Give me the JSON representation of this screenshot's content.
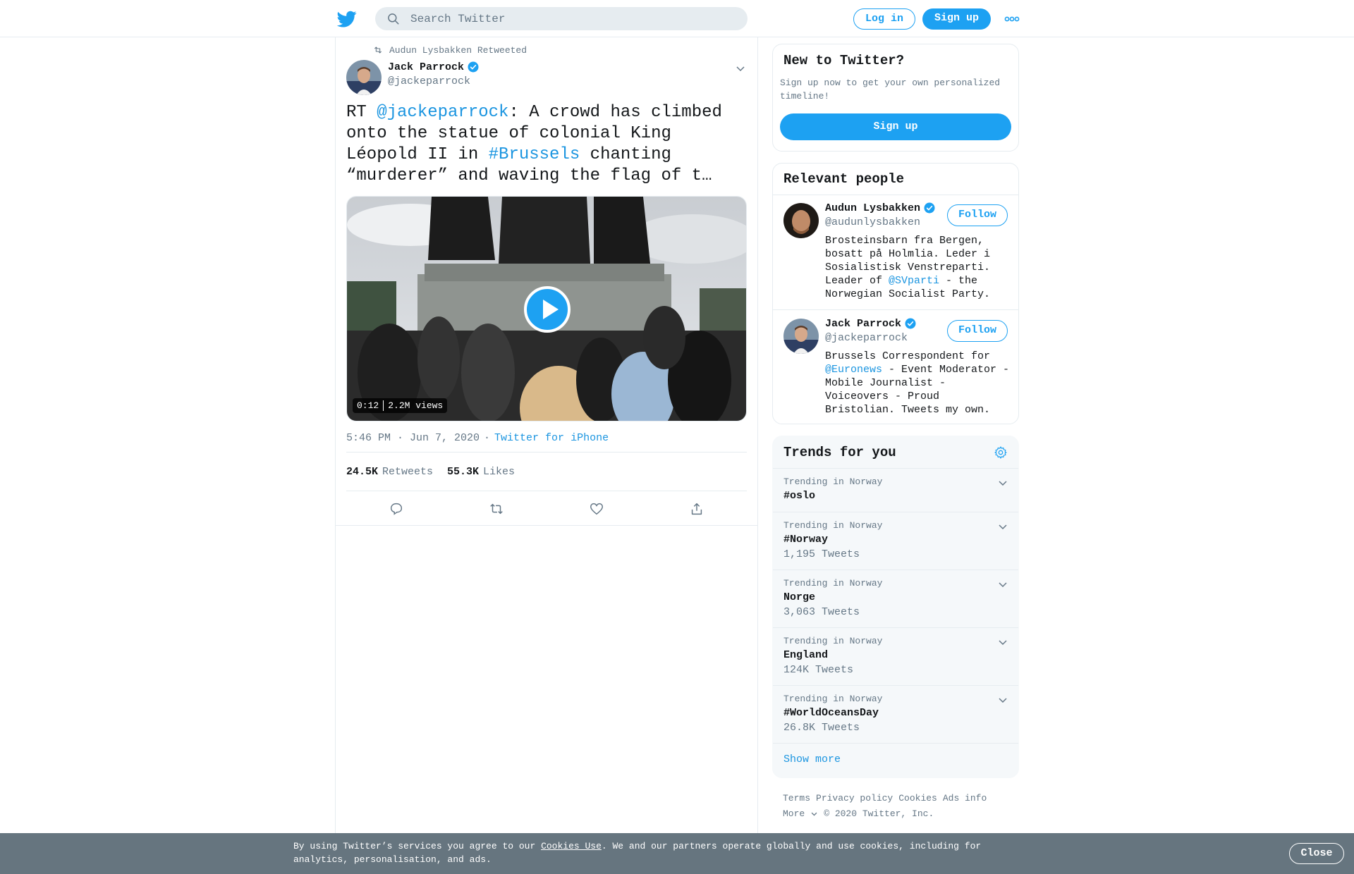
{
  "header": {
    "search_placeholder": "Search Twitter",
    "login_label": "Log in",
    "signup_label": "Sign up",
    "icons": [
      "twitter-bird-icon",
      "search-icon",
      "more-dots-icon"
    ]
  },
  "tweet": {
    "retweeted_by": "Audun Lysbakken Retweeted",
    "author_name": "Jack Parrock",
    "author_handle": "@jackeparrock",
    "text_prefix": "RT ",
    "text_mention": "@jackeparrock",
    "text_mid": ": A crowd has climbed onto the statue of colonial King Léopold II in ",
    "text_hashtag": "#Brussels",
    "text_suffix": " chanting “murderer” and waving the flag of t…",
    "video_duration": "0:12",
    "video_views": "2.2M views",
    "time": "5:46 PM · Jun 7, 2020",
    "source_sep": "·",
    "source": "Twitter for iPhone",
    "retweets_count": "24.5K",
    "retweets_label": "Retweets",
    "likes_count": "55.3K",
    "likes_label": "Likes",
    "actions": [
      "reply-icon",
      "retweet-icon",
      "like-icon",
      "share-icon"
    ]
  },
  "new_to_twitter": {
    "title": "New to Twitter?",
    "subtitle": "Sign up now to get your own personalized timeline!",
    "button": "Sign up"
  },
  "relevant_people": {
    "title": "Relevant people",
    "people": [
      {
        "name": "Audun Lysbakken",
        "handle": "@audunlysbakken",
        "follow": "Follow",
        "bio_1": "Brosteinsbarn fra Bergen, bosatt på Holmlia. Leder i Sosialistisk Venstreparti. Leader of ",
        "bio_link": "@SVparti",
        "bio_2": " - the Norwegian Socialist Party."
      },
      {
        "name": "Jack Parrock",
        "handle": "@jackeparrock",
        "follow": "Follow",
        "bio_1": "Brussels Correspondent for ",
        "bio_link": "@Euronews",
        "bio_2": " - Event Moderator - Mobile Journalist - Voiceovers - Proud Bristolian. Tweets my own."
      }
    ]
  },
  "trends": {
    "title": "Trends for you",
    "items": [
      {
        "context": "Trending in Norway",
        "name": "#oslo",
        "count": ""
      },
      {
        "context": "Trending in Norway",
        "name": "#Norway",
        "count": "1,195 Tweets"
      },
      {
        "context": "Trending in Norway",
        "name": "Norge",
        "count": "3,063 Tweets"
      },
      {
        "context": "Trending in Norway",
        "name": "England",
        "count": "124K Tweets"
      },
      {
        "context": "Trending in Norway",
        "name": "#WorldOceansDay",
        "count": "26.8K Tweets"
      }
    ],
    "show_more": "Show more"
  },
  "footer": {
    "terms": "Terms",
    "privacy": "Privacy policy",
    "cookies": "Cookies",
    "ads": "Ads info",
    "more": "More",
    "copyright": "© 2020 Twitter, Inc."
  },
  "cookie_bar": {
    "text_1": "By using Twitter’s services you agree to our ",
    "link": "Cookies Use",
    "text_2": ". We and our partners operate globally and use cookies, including for analytics, personalisation, and ads.",
    "close": "Close"
  },
  "colors": {
    "accent": "#1da1f2",
    "link": "#1b95e0",
    "muted": "#657786",
    "cookie_bar_bg": "#66757f"
  }
}
